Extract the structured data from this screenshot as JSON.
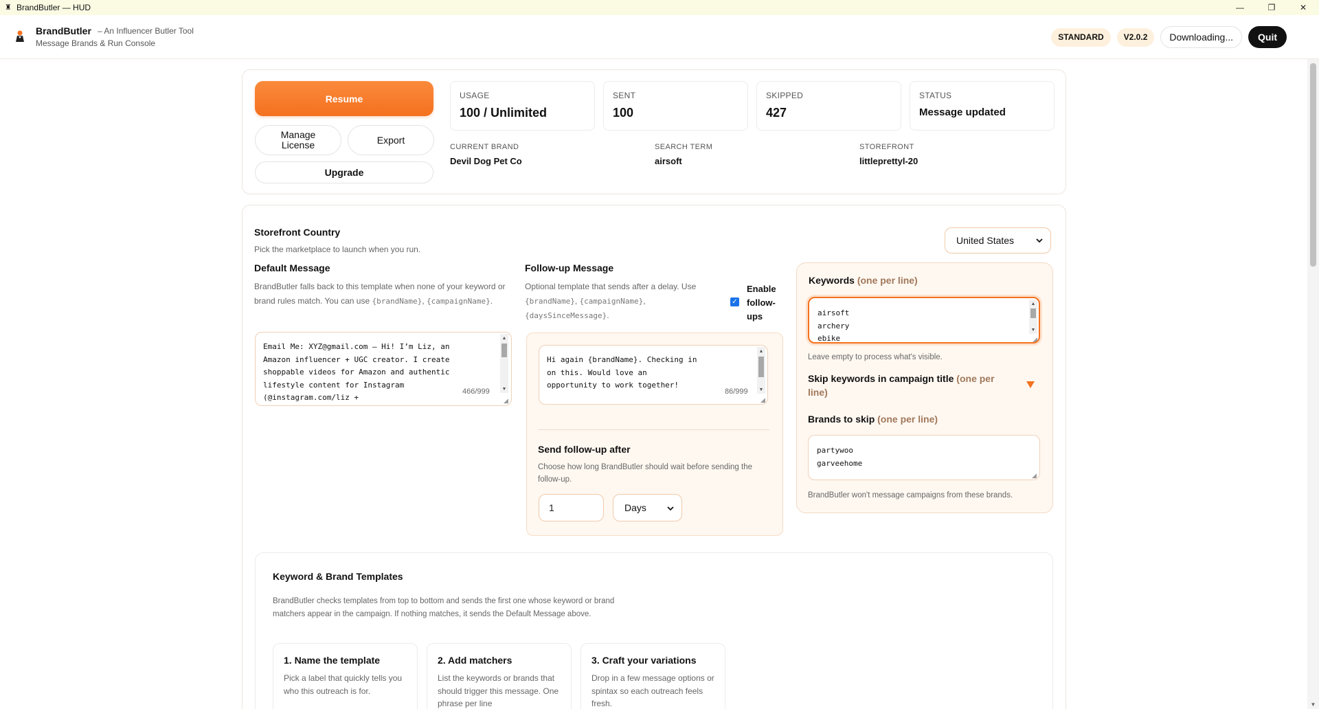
{
  "window": {
    "title": "BrandButler — HUD",
    "controls": {
      "minimize": "—",
      "maximize": "❐",
      "close": "✕"
    }
  },
  "header": {
    "app_name": "BrandButler",
    "tagline": "– An Influencer Butler Tool",
    "subtitle": "Message Brands & Run Console",
    "plan_badge": "STANDARD",
    "version_badge": "V2.0.2",
    "download_label": "Downloading...",
    "quit_label": "Quit"
  },
  "controls": {
    "resume_label": "Resume",
    "manage_label": "Manage License",
    "export_label": "Export",
    "upgrade_label": "Upgrade"
  },
  "stats": [
    {
      "label": "USAGE",
      "value": "100 / Unlimited"
    },
    {
      "label": "SENT",
      "value": "100"
    },
    {
      "label": "SKIPPED",
      "value": "427"
    },
    {
      "label": "STATUS",
      "value": "Message updated"
    }
  ],
  "meta": [
    {
      "label": "CURRENT BRAND",
      "value": "Devil Dog Pet Co"
    },
    {
      "label": "SEARCH TERM",
      "value": "airsoft"
    },
    {
      "label": "STOREFRONT",
      "value": "littleprettyl-20"
    }
  ],
  "storefront": {
    "title": "Storefront Country",
    "desc": "Pick the marketplace to launch when you run.",
    "selected": "United States"
  },
  "default_message": {
    "title": "Default Message",
    "desc_pre": "BrandButler falls back to this template when none of your keyword or brand rules match. You can use ",
    "token1": "{brandName}",
    "sep": ", ",
    "token2": "{campaignName}",
    "desc_post": ".",
    "text": "Email Me: XYZ@gmail.com – Hi! I’m Liz, an\nAmazon influencer + UGC creator. I create\nshoppable videos for Amazon and authentic\nlifestyle content for Instagram\n(@instagram.com/liz +\n@amazon.com/shop/littleprettyliz). I'd",
    "counter": "466/999"
  },
  "followup": {
    "title": "Follow-up Message",
    "desc_pre": "Optional template that sends after a delay. Use ",
    "token1": "{brandName}",
    "sep1": ", ",
    "token2": "{campaignName}",
    "sep2": ", ",
    "token3": "{daysSinceMessage}",
    "desc_post": ".",
    "enable_label": "Enable follow-ups",
    "enabled": true,
    "text": "Hi again {brandName}. Checking in\non this. Would love an\nopportunity to work together!",
    "counter": "86/999",
    "send_after_title": "Send follow-up after",
    "send_after_desc": "Choose how long BrandButler should wait before sending the follow-up.",
    "delay_value": "1",
    "delay_unit": "Days"
  },
  "keywords": {
    "title": "Keywords",
    "title_hint": "(one per line)",
    "text": "airsoft\narchery\nebike",
    "help": "Leave empty to process what's visible.",
    "skip_title": "Skip keywords in campaign title",
    "skip_hint": "(one per line)",
    "brands_title": "Brands to skip",
    "brands_hint": "(one per line)",
    "brands_text": "partywoo\ngarveehome",
    "brands_help": "BrandButler won't message campaigns from these brands."
  },
  "templates": {
    "title": "Keyword & Brand Templates",
    "desc": "BrandButler checks templates from top to bottom and sends the first one whose keyword or brand matchers appear in the campaign. If nothing matches, it sends the Default Message above.",
    "steps": [
      {
        "title": "1. Name the template",
        "desc": "Pick a label that quickly tells you who this outreach is for."
      },
      {
        "title": "2. Add matchers",
        "desc": "List the keywords or brands that should trigger this message. One phrase per line"
      },
      {
        "title": "3. Craft your variations",
        "desc": "Drop in a few message options or spintax so each outreach feels fresh."
      }
    ]
  },
  "colors": {
    "accent": "#f3711f",
    "accent_light": "#fb8a3c",
    "panel_tint": "#fff8f1",
    "badge_bg": "#fdf0dc",
    "checkbox": "#1a73e8"
  }
}
